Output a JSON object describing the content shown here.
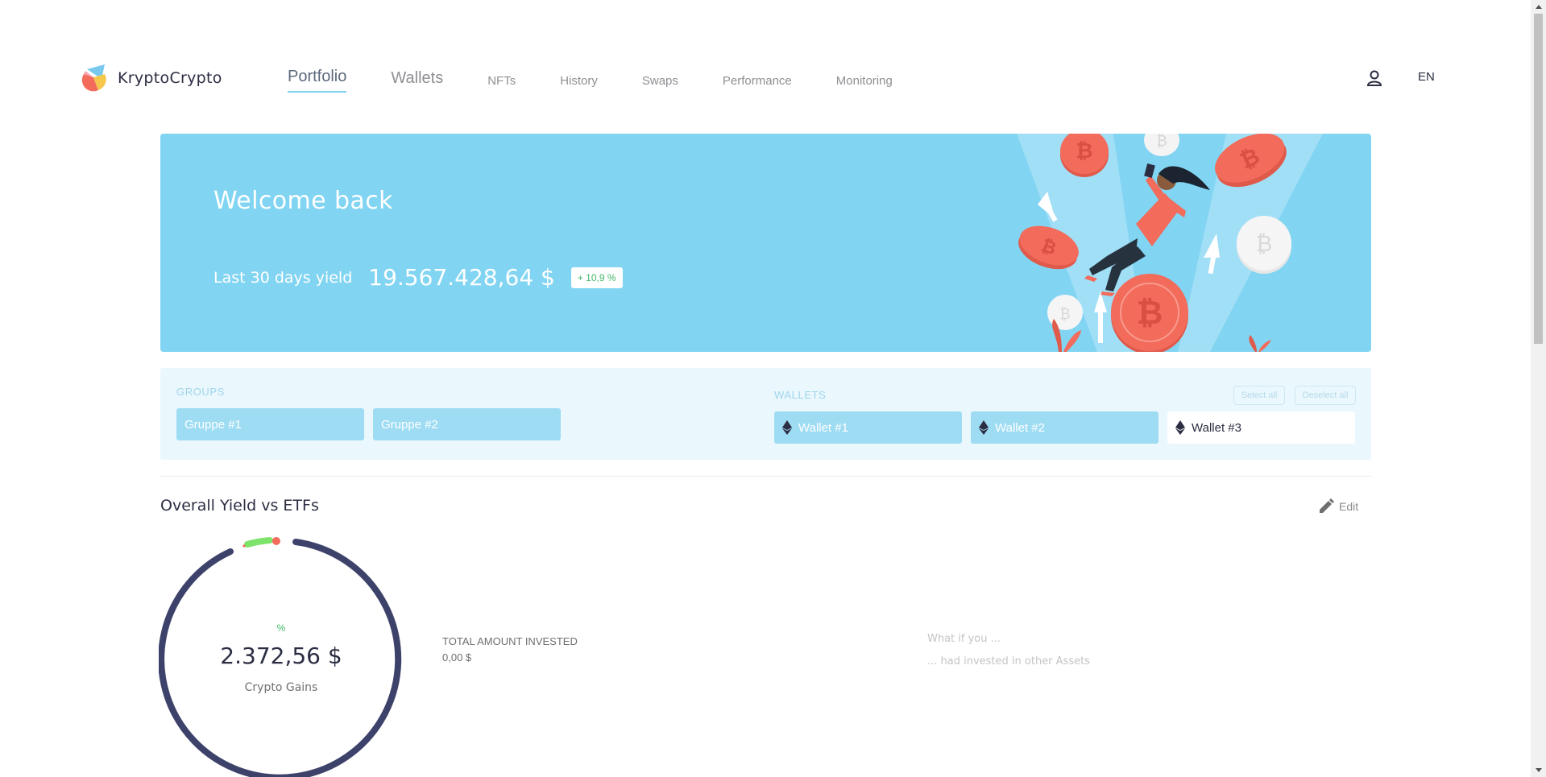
{
  "header": {
    "brand": "KryptoCrypto",
    "nav": [
      {
        "label": "Portfolio",
        "active": true
      },
      {
        "label": "Wallets",
        "active": false
      },
      {
        "label": "NFTs",
        "active": false
      },
      {
        "label": "History",
        "active": false
      },
      {
        "label": "Swaps",
        "active": false
      },
      {
        "label": "Performance",
        "active": false
      },
      {
        "label": "Monitoring",
        "active": false
      }
    ],
    "user_icon": "user-icon",
    "language": "EN"
  },
  "hero": {
    "title": "Welcome back",
    "yield_label": "Last 30 days yield",
    "yield_value": "19.567.428,64 $",
    "yield_change": "+ 10,9 %",
    "illustration": "crypto-bitcoin-coins-illustration"
  },
  "selector": {
    "groups_heading": "GROUPS",
    "groups": [
      {
        "label": "Gruppe #1",
        "selected": true
      },
      {
        "label": "Gruppe #2",
        "selected": true
      }
    ],
    "wallets_heading": "WALLETS",
    "select_all": "Select all",
    "deselect_all": "Deselect all",
    "wallets": [
      {
        "label": "Wallet #1",
        "selected": true,
        "icon": "ethereum-icon"
      },
      {
        "label": "Wallet #2",
        "selected": true,
        "icon": "ethereum-icon"
      },
      {
        "label": "Wallet #3",
        "selected": false,
        "icon": "ethereum-icon"
      }
    ]
  },
  "overview": {
    "title": "Overall Yield vs ETFs",
    "edit_label": "Edit",
    "donut_percent": "%",
    "donut_value": "2.372,56 $",
    "donut_label": "Crypto Gains",
    "total_invested_label": "TOTAL AMOUNT INVESTED",
    "total_invested_value": "0,00 $",
    "whatif_line1": "What if you ...",
    "whatif_line2": "... had invested in other Assets"
  },
  "colors": {
    "accent": "#81d4f2",
    "chip": "#9edcf3",
    "panel": "#eaf7fd",
    "donut_ring": "#3d426b",
    "positive": "#43b86a",
    "coin": "#f26b5b"
  }
}
